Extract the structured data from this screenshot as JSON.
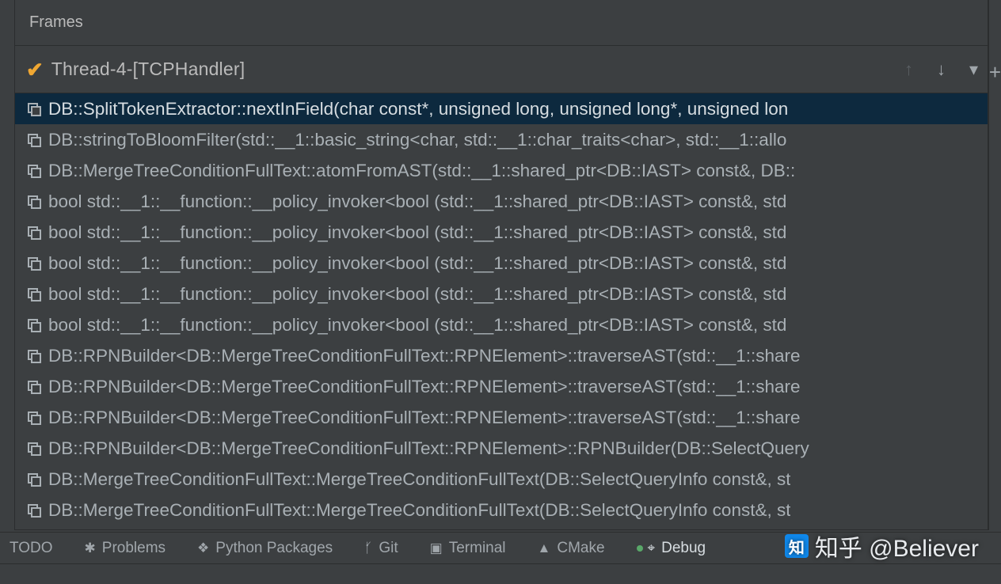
{
  "header": {
    "title": "Frames"
  },
  "thread": {
    "name": "Thread-4-[TCPHandler]"
  },
  "frames": [
    {
      "selected": true,
      "label": "DB::SplitTokenExtractor::nextInField(char const*, unsigned long, unsigned long*, unsigned lon"
    },
    {
      "selected": false,
      "label": "DB::stringToBloomFilter(std::__1::basic_string<char, std::__1::char_traits<char>, std::__1::allo"
    },
    {
      "selected": false,
      "label": "DB::MergeTreeConditionFullText::atomFromAST(std::__1::shared_ptr<DB::IAST> const&, DB::"
    },
    {
      "selected": false,
      "label": "bool std::__1::__function::__policy_invoker<bool (std::__1::shared_ptr<DB::IAST> const&, std"
    },
    {
      "selected": false,
      "label": "bool std::__1::__function::__policy_invoker<bool (std::__1::shared_ptr<DB::IAST> const&, std"
    },
    {
      "selected": false,
      "label": "bool std::__1::__function::__policy_invoker<bool (std::__1::shared_ptr<DB::IAST> const&, std"
    },
    {
      "selected": false,
      "label": "bool std::__1::__function::__policy_invoker<bool (std::__1::shared_ptr<DB::IAST> const&, std"
    },
    {
      "selected": false,
      "label": "bool std::__1::__function::__policy_invoker<bool (std::__1::shared_ptr<DB::IAST> const&, std"
    },
    {
      "selected": false,
      "label": "DB::RPNBuilder<DB::MergeTreeConditionFullText::RPNElement>::traverseAST(std::__1::share"
    },
    {
      "selected": false,
      "label": "DB::RPNBuilder<DB::MergeTreeConditionFullText::RPNElement>::traverseAST(std::__1::share"
    },
    {
      "selected": false,
      "label": "DB::RPNBuilder<DB::MergeTreeConditionFullText::RPNElement>::traverseAST(std::__1::share"
    },
    {
      "selected": false,
      "label": "DB::RPNBuilder<DB::MergeTreeConditionFullText::RPNElement>::RPNBuilder(DB::SelectQuery"
    },
    {
      "selected": false,
      "label": "DB::MergeTreeConditionFullText::MergeTreeConditionFullText(DB::SelectQueryInfo const&, st"
    },
    {
      "selected": false,
      "label": "DB::MergeTreeConditionFullText::MergeTreeConditionFullText(DB::SelectQueryInfo const&, st"
    }
  ],
  "bottom_tabs": {
    "todo": "TODO",
    "problems": "Problems",
    "python_packages": "Python Packages",
    "git": "Git",
    "terminal": "Terminal",
    "cmake": "CMake",
    "debug": "Debug"
  },
  "watermark": {
    "logo_char": "知",
    "text": "知乎 @Believer"
  }
}
